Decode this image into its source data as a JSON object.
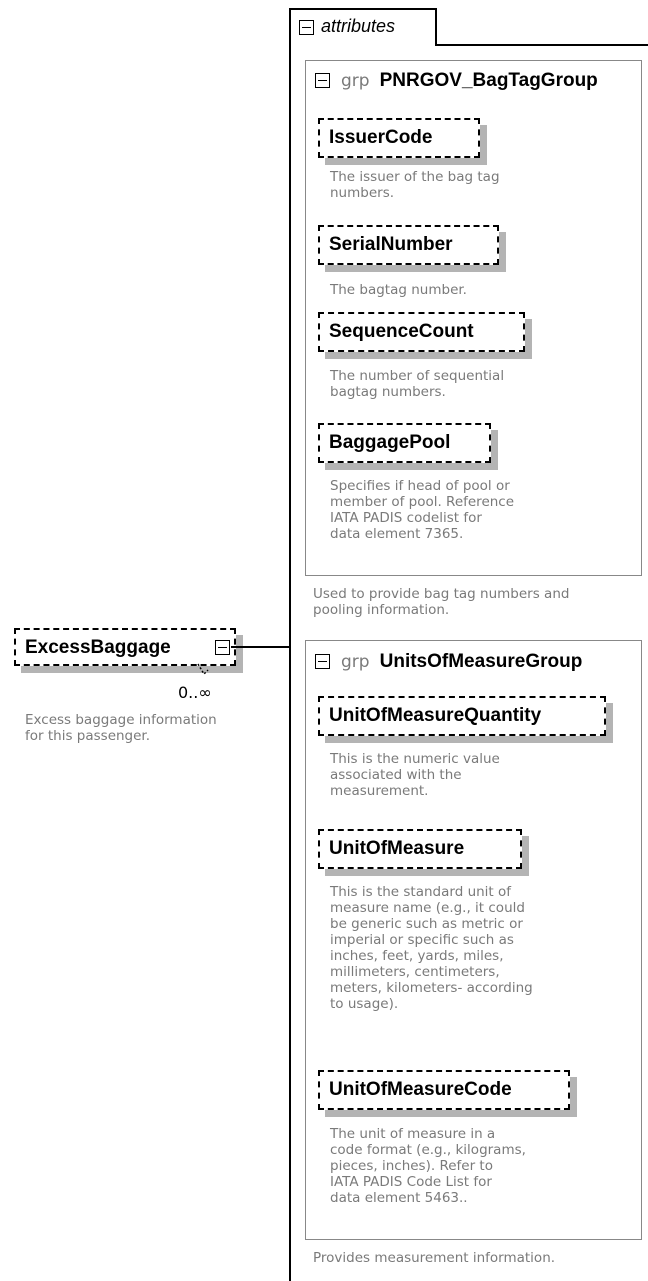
{
  "excess_baggage": {
    "name": "ExcessBaggage",
    "cardinality": "0..∞",
    "description": [
      "Excess baggage information",
      "for this passenger."
    ]
  },
  "attributes_tab": {
    "label": "attributes"
  },
  "bag_tag_group": {
    "keyword": "grp",
    "name": "PNRGOV_BagTagGroup",
    "description": [
      "Used to provide bag tag numbers and",
      "pooling information."
    ],
    "elements": [
      {
        "name": "IssuerCode",
        "description": [
          "The issuer of the bag tag",
          "numbers."
        ]
      },
      {
        "name": "SerialNumber",
        "description": [
          "The bagtag number."
        ]
      },
      {
        "name": "SequenceCount",
        "description": [
          "The number of sequential",
          "bagtag numbers."
        ]
      },
      {
        "name": "BaggagePool",
        "description": [
          "Specifies if head of pool or",
          "member of pool.  Reference",
          "IATA PADIS codelist for",
          "data element 7365."
        ]
      }
    ]
  },
  "units_group": {
    "keyword": "grp",
    "name": "UnitsOfMeasureGroup",
    "description": [
      "Provides measurement information."
    ],
    "elements": [
      {
        "name": "UnitOfMeasureQuantity",
        "description": [
          "This is the numeric value",
          "associated with the",
          "measurement."
        ]
      },
      {
        "name": "UnitOfMeasure",
        "description": [
          "This is the standard unit of",
          "measure name (e.g., it could",
          "be generic such as metric or",
          "imperial or specific such as",
          "inches, feet, yards, miles,",
          "millimeters, centimeters,",
          "meters, kilometers- according",
          "to usage)."
        ]
      },
      {
        "name": "UnitOfMeasureCode",
        "description": [
          "The unit of measure in a",
          "code format (e.g., kilograms,",
          "pieces, inches). Refer to",
          "IATA PADIS Code List for",
          "data element 5463.."
        ]
      }
    ]
  }
}
